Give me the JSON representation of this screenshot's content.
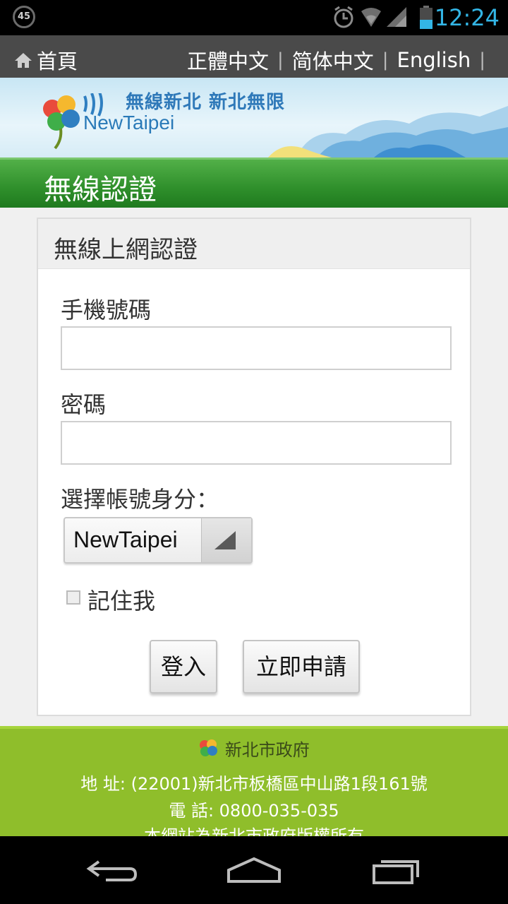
{
  "status_bar": {
    "badge": "45",
    "clock": "12:24",
    "icons": [
      "alarm-icon",
      "wifi-icon",
      "signal-icon",
      "battery-icon"
    ]
  },
  "nav": {
    "home_label": "首頁",
    "languages": [
      "正體中文",
      "简体中文",
      "English"
    ]
  },
  "banner": {
    "tagline": "無線新北 新北無限",
    "brand": "NewTaipei"
  },
  "page_title": "無線認證",
  "form": {
    "panel_title": "無線上網認證",
    "phone_label": "手機號碼",
    "phone_value": "",
    "password_label": "密碼",
    "password_value": "",
    "identity_label": "選擇帳號身分：",
    "identity_selected": "NewTaipei",
    "remember_label": "記住我",
    "remember_checked": false,
    "login_button": "登入",
    "register_button": "立即申請"
  },
  "footer": {
    "gov_name": "新北市政府",
    "address": "地 址: (22001)新北市板橋區中山路1段161號",
    "phone": "電 話: 0800-035-035",
    "copyright": "本網站為新北市政府版權所有"
  },
  "colors": {
    "status_accent": "#33b5e5",
    "nav_bg": "#4a4a4a",
    "title_green": "#2f8f2b",
    "footer_green": "#8fbe2b"
  }
}
